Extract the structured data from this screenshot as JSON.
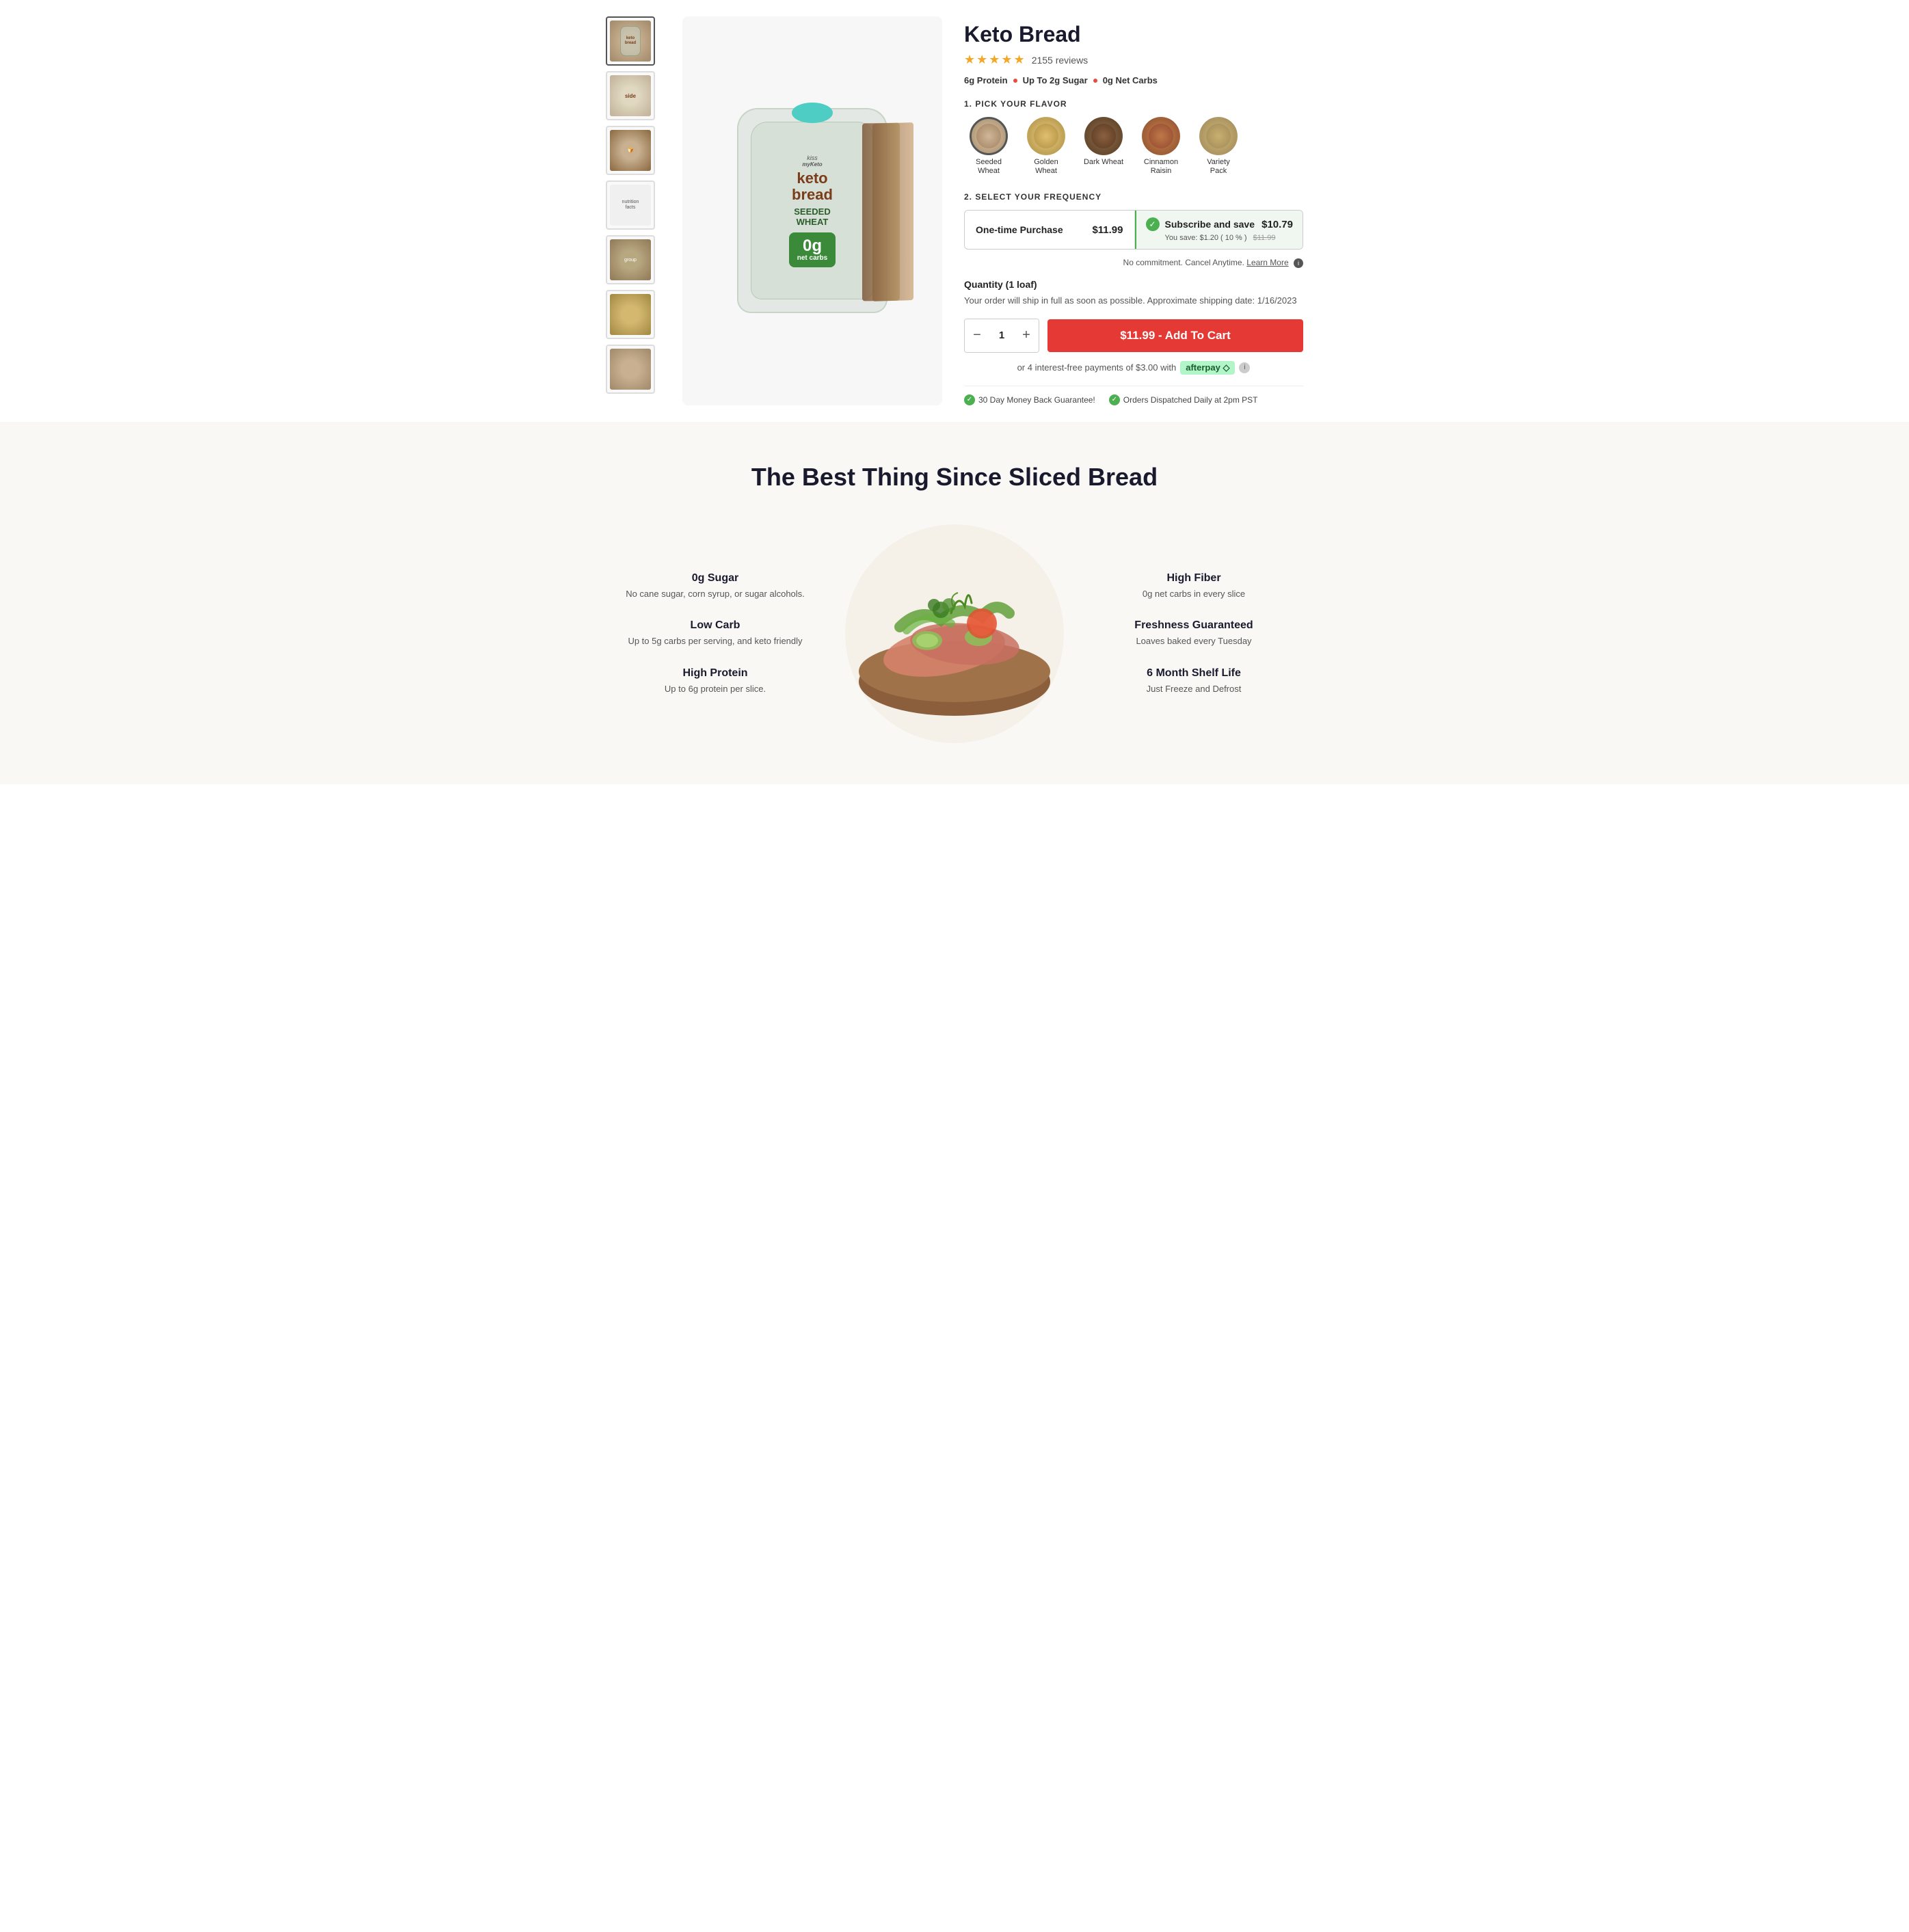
{
  "product": {
    "title": "Keto Bread",
    "rating": "★★★★★",
    "review_count": "2155 reviews",
    "badges": [
      "6g Protein",
      "Up To 2g Sugar",
      "0g Net Carbs"
    ],
    "section1_label": "1. PICK YOUR FLAVOR",
    "flavors": [
      {
        "id": "seeded-wheat",
        "name": "Seeded\nWheat",
        "selected": true,
        "color_class": "tv-seeded"
      },
      {
        "id": "golden-wheat",
        "name": "Golden\nWheat",
        "selected": false,
        "color_class": "tv-golden"
      },
      {
        "id": "dark-wheat",
        "name": "Dark Wheat",
        "selected": false,
        "color_class": "tv-dark"
      },
      {
        "id": "cinnamon-raisin",
        "name": "Cinnamon\nRaisin",
        "selected": false,
        "color_class": "tv-cinnamon"
      },
      {
        "id": "variety-pack",
        "name": "Variety\nPack",
        "selected": false,
        "color_class": "tv-variety"
      }
    ],
    "section2_label": "2. SELECT YOUR FREQUENCY",
    "frequency_options": [
      {
        "id": "one-time",
        "label": "One-time Purchase",
        "price": "$11.99",
        "selected": false
      },
      {
        "id": "subscribe",
        "label": "Subscribe and save",
        "price": "$10.79",
        "sub": "You save: $1.20 ( 10 % )",
        "original_price": "$11.99",
        "selected": true
      }
    ],
    "no_commitment": "No commitment. Cancel Anytime.",
    "learn_more": "Learn More",
    "quantity_label": "Quantity (1 loaf)",
    "shipping_note": "Your order will ship in full as soon as possible. Approximate shipping date: 1/16/2023",
    "quantity_value": "1",
    "qty_minus": "−",
    "qty_plus": "+",
    "add_to_cart": "$11.99 - Add To Cart",
    "afterpay_text": "or 4 interest-free payments of $3.00 with",
    "afterpay_label": "afterpay ◇",
    "guarantees": [
      "30 Day Money Back Guarantee!",
      "Orders Dispatched Daily at 2pm PST"
    ]
  },
  "thumbnails": [
    {
      "id": "thumb-1",
      "alt": "Seeded Wheat bag"
    },
    {
      "id": "thumb-2",
      "alt": "Side view"
    },
    {
      "id": "thumb-3",
      "alt": "Sandwich view"
    },
    {
      "id": "thumb-4",
      "alt": "Nutrition label"
    },
    {
      "id": "thumb-5",
      "alt": "Product group"
    },
    {
      "id": "thumb-6",
      "alt": "Loaf view 1"
    },
    {
      "id": "thumb-7",
      "alt": "Loaf view 2"
    }
  ],
  "benefits": {
    "section_title": "The Best Thing Since Sliced Bread",
    "left_items": [
      {
        "title": "0g Sugar",
        "desc": "No cane sugar, corn syrup, or sugar alcohols."
      },
      {
        "title": "Low Carb",
        "desc": "Up to 5g carbs per serving, and keto friendly"
      },
      {
        "title": "High Protein",
        "desc": "Up to 6g protein per slice."
      }
    ],
    "right_items": [
      {
        "title": "High Fiber",
        "desc": "0g net carbs in every slice"
      },
      {
        "title": "Freshness Guaranteed",
        "desc": "Loaves baked every Tuesday"
      },
      {
        "title": "6 Month Shelf Life",
        "desc": "Just Freeze and Defrost"
      }
    ]
  }
}
